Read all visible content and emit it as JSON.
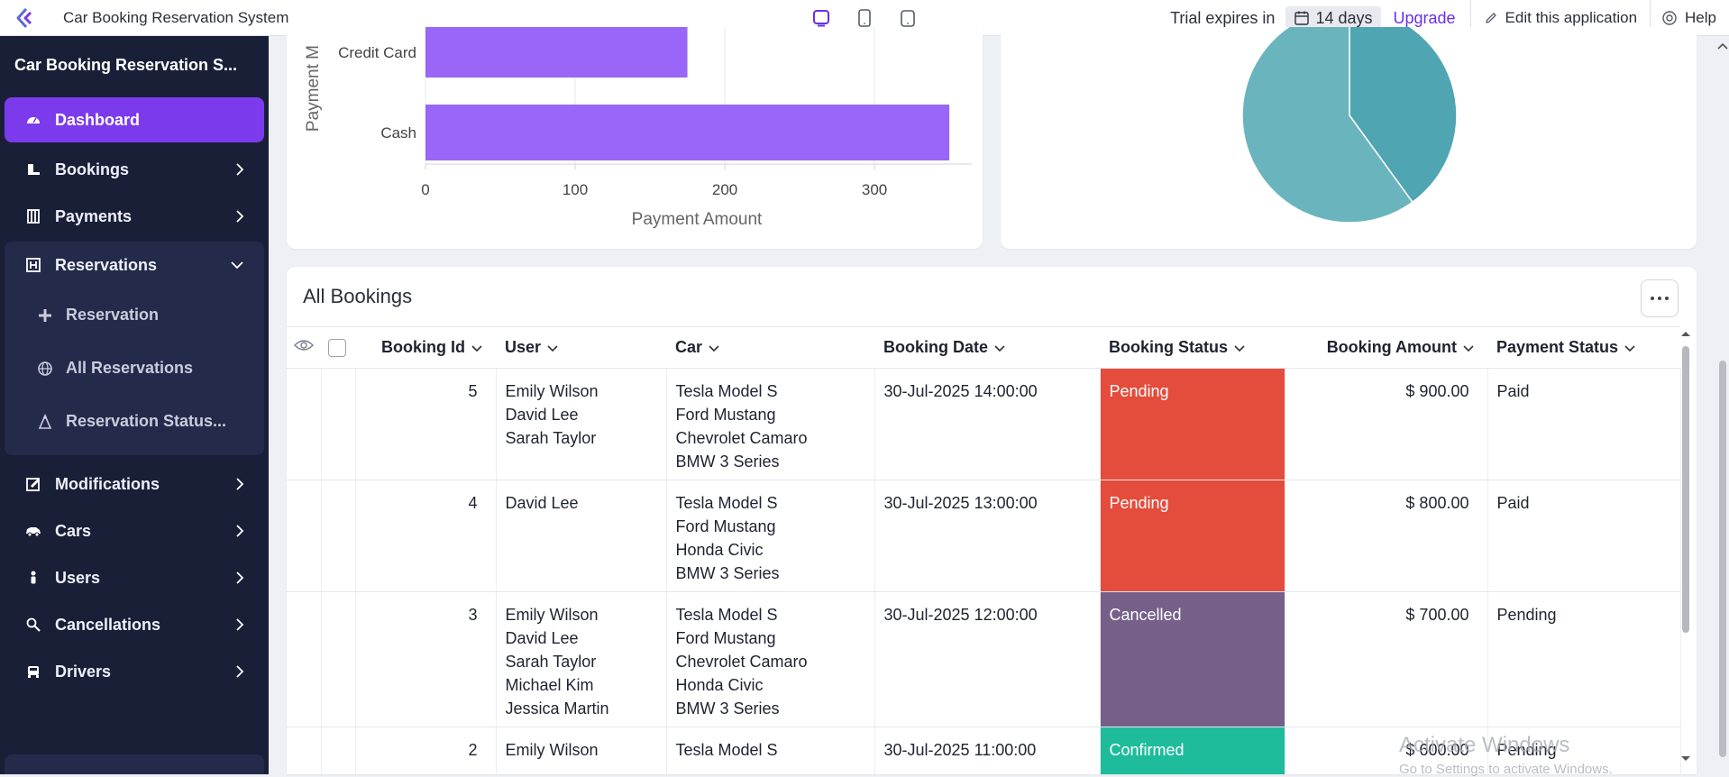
{
  "topbar": {
    "app_title": "Car Booking Reservation System",
    "trial_label": "Trial expires in",
    "days_left": "14 days",
    "upgrade_label": "Upgrade",
    "edit_label": "Edit this application",
    "help_label": "Help"
  },
  "sidebar": {
    "title": "Car Booking Reservation S...",
    "items": [
      {
        "label": "Dashboard",
        "icon": "dashboard-icon",
        "active": true
      },
      {
        "label": "Bookings",
        "icon": "bookings-icon"
      },
      {
        "label": "Payments",
        "icon": "payments-icon"
      },
      {
        "label": "Reservations",
        "icon": "reservations-icon",
        "expanded": true
      },
      {
        "label": "Modifications",
        "icon": "modifications-icon"
      },
      {
        "label": "Cars",
        "icon": "car-icon"
      },
      {
        "label": "Users",
        "icon": "user-icon"
      },
      {
        "label": "Cancellations",
        "icon": "cancellations-icon"
      },
      {
        "label": "Drivers",
        "icon": "driver-icon"
      }
    ],
    "reservation_sub": [
      {
        "label": "Reservation",
        "icon": "plus-icon"
      },
      {
        "label": "All Reservations",
        "icon": "globe-icon"
      },
      {
        "label": "Reservation Status...",
        "icon": "status-icon"
      }
    ]
  },
  "colors": {
    "accent": "#7c3aed",
    "bar": "#9966f8",
    "pie_light": "#6ab5bd",
    "pie_dark": "#4fa5b1",
    "pending": "#e44c3c",
    "cancelled": "#76608a",
    "confirmed": "#1fbc9c"
  },
  "chart_data": [
    {
      "type": "bar",
      "orientation": "horizontal",
      "categories": [
        "Credit Card",
        "Cash"
      ],
      "values": [
        175,
        350
      ],
      "xlabel": "Payment Amount",
      "ylabel": "Payment M",
      "xticks": [
        "0",
        "100",
        "200",
        "300"
      ],
      "xlim": [
        0,
        365
      ]
    },
    {
      "type": "pie",
      "values": [
        40,
        60
      ],
      "colors": [
        "#4fa5b1",
        "#6ab5bd"
      ]
    }
  ],
  "table": {
    "title": "All Bookings",
    "columns": [
      "Booking Id",
      "User",
      "Car",
      "Booking Date",
      "Booking Status",
      "Booking Amount",
      "Payment Status"
    ],
    "rows": [
      {
        "id": "5",
        "users": [
          "Emily Wilson",
          "David Lee",
          "Sarah Taylor"
        ],
        "cars": [
          "Tesla Model S",
          "Ford Mustang",
          "Chevrolet Camaro",
          "BMW 3 Series"
        ],
        "date": "30-Jul-2025 14:00:00",
        "status": "Pending",
        "amount": "$ 900.00",
        "payment": "Paid"
      },
      {
        "id": "4",
        "users": [
          "David Lee"
        ],
        "cars": [
          "Tesla Model S",
          "Ford Mustang",
          "Honda Civic",
          "BMW 3 Series"
        ],
        "date": "30-Jul-2025 13:00:00",
        "status": "Pending",
        "amount": "$ 800.00",
        "payment": "Paid"
      },
      {
        "id": "3",
        "users": [
          "Emily Wilson",
          "David Lee",
          "Sarah Taylor",
          "Michael Kim",
          "Jessica Martin"
        ],
        "cars": [
          "Tesla Model S",
          "Ford Mustang",
          "Chevrolet Camaro",
          "Honda Civic",
          "BMW 3 Series"
        ],
        "date": "30-Jul-2025 12:00:00",
        "status": "Cancelled",
        "amount": "$ 700.00",
        "payment": "Pending"
      },
      {
        "id": "2",
        "users": [
          "Emily Wilson"
        ],
        "cars": [
          "Tesla Model S"
        ],
        "date": "30-Jul-2025 11:00:00",
        "status": "Confirmed",
        "amount": "$ 600.00",
        "payment": "Pending"
      }
    ]
  },
  "watermark": {
    "line1": "Activate Windows",
    "line2": "Go to Settings to activate Windows."
  }
}
